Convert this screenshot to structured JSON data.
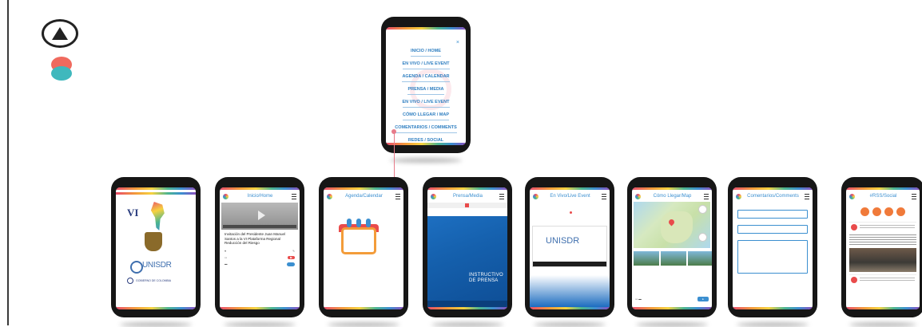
{
  "menu": {
    "close_label": "×",
    "items": [
      {
        "label": "INICIO / HOME"
      },
      {
        "label": "EN VIVO / LIVE EVENT"
      },
      {
        "label": "AGENDA / CALENDAR"
      },
      {
        "label": "PRENSA / MEDIA"
      },
      {
        "label": "EN VIVO / LIVE EVENT"
      },
      {
        "label": "CÓMO LLEGAR / MAP"
      },
      {
        "label": "COMENTARIOS / COMMENTS"
      },
      {
        "label": "REDES / SOCIAL"
      }
    ]
  },
  "screens": {
    "home": {
      "vi": "VI",
      "un_name": "UNISDR",
      "gov": "GOBIERNO DE COLOMBIA"
    },
    "inicio": {
      "title": "Inicio/Home",
      "article": "Invitación del Presidente Juan Manuel Santos a la VI Plataforma Regional Reducción del Riesgo"
    },
    "agenda": {
      "title": "Agenda/Calendar"
    },
    "prensa": {
      "title": "Prensa/Media",
      "press_title": "INSTRUCTIVO DE PRENSA"
    },
    "vivo": {
      "title": "En Vivo/Live Event",
      "un_name": "UNISDR"
    },
    "mapa": {
      "title": "Cómo Llegar/Map"
    },
    "comentarios": {
      "title": "Comentarios/Comments"
    },
    "redes": {
      "title": "#RSS/Social"
    }
  },
  "colors": {
    "accent": "#3b8fd0",
    "brand_red": "#e94b6b",
    "connector": "#e77b8a"
  }
}
